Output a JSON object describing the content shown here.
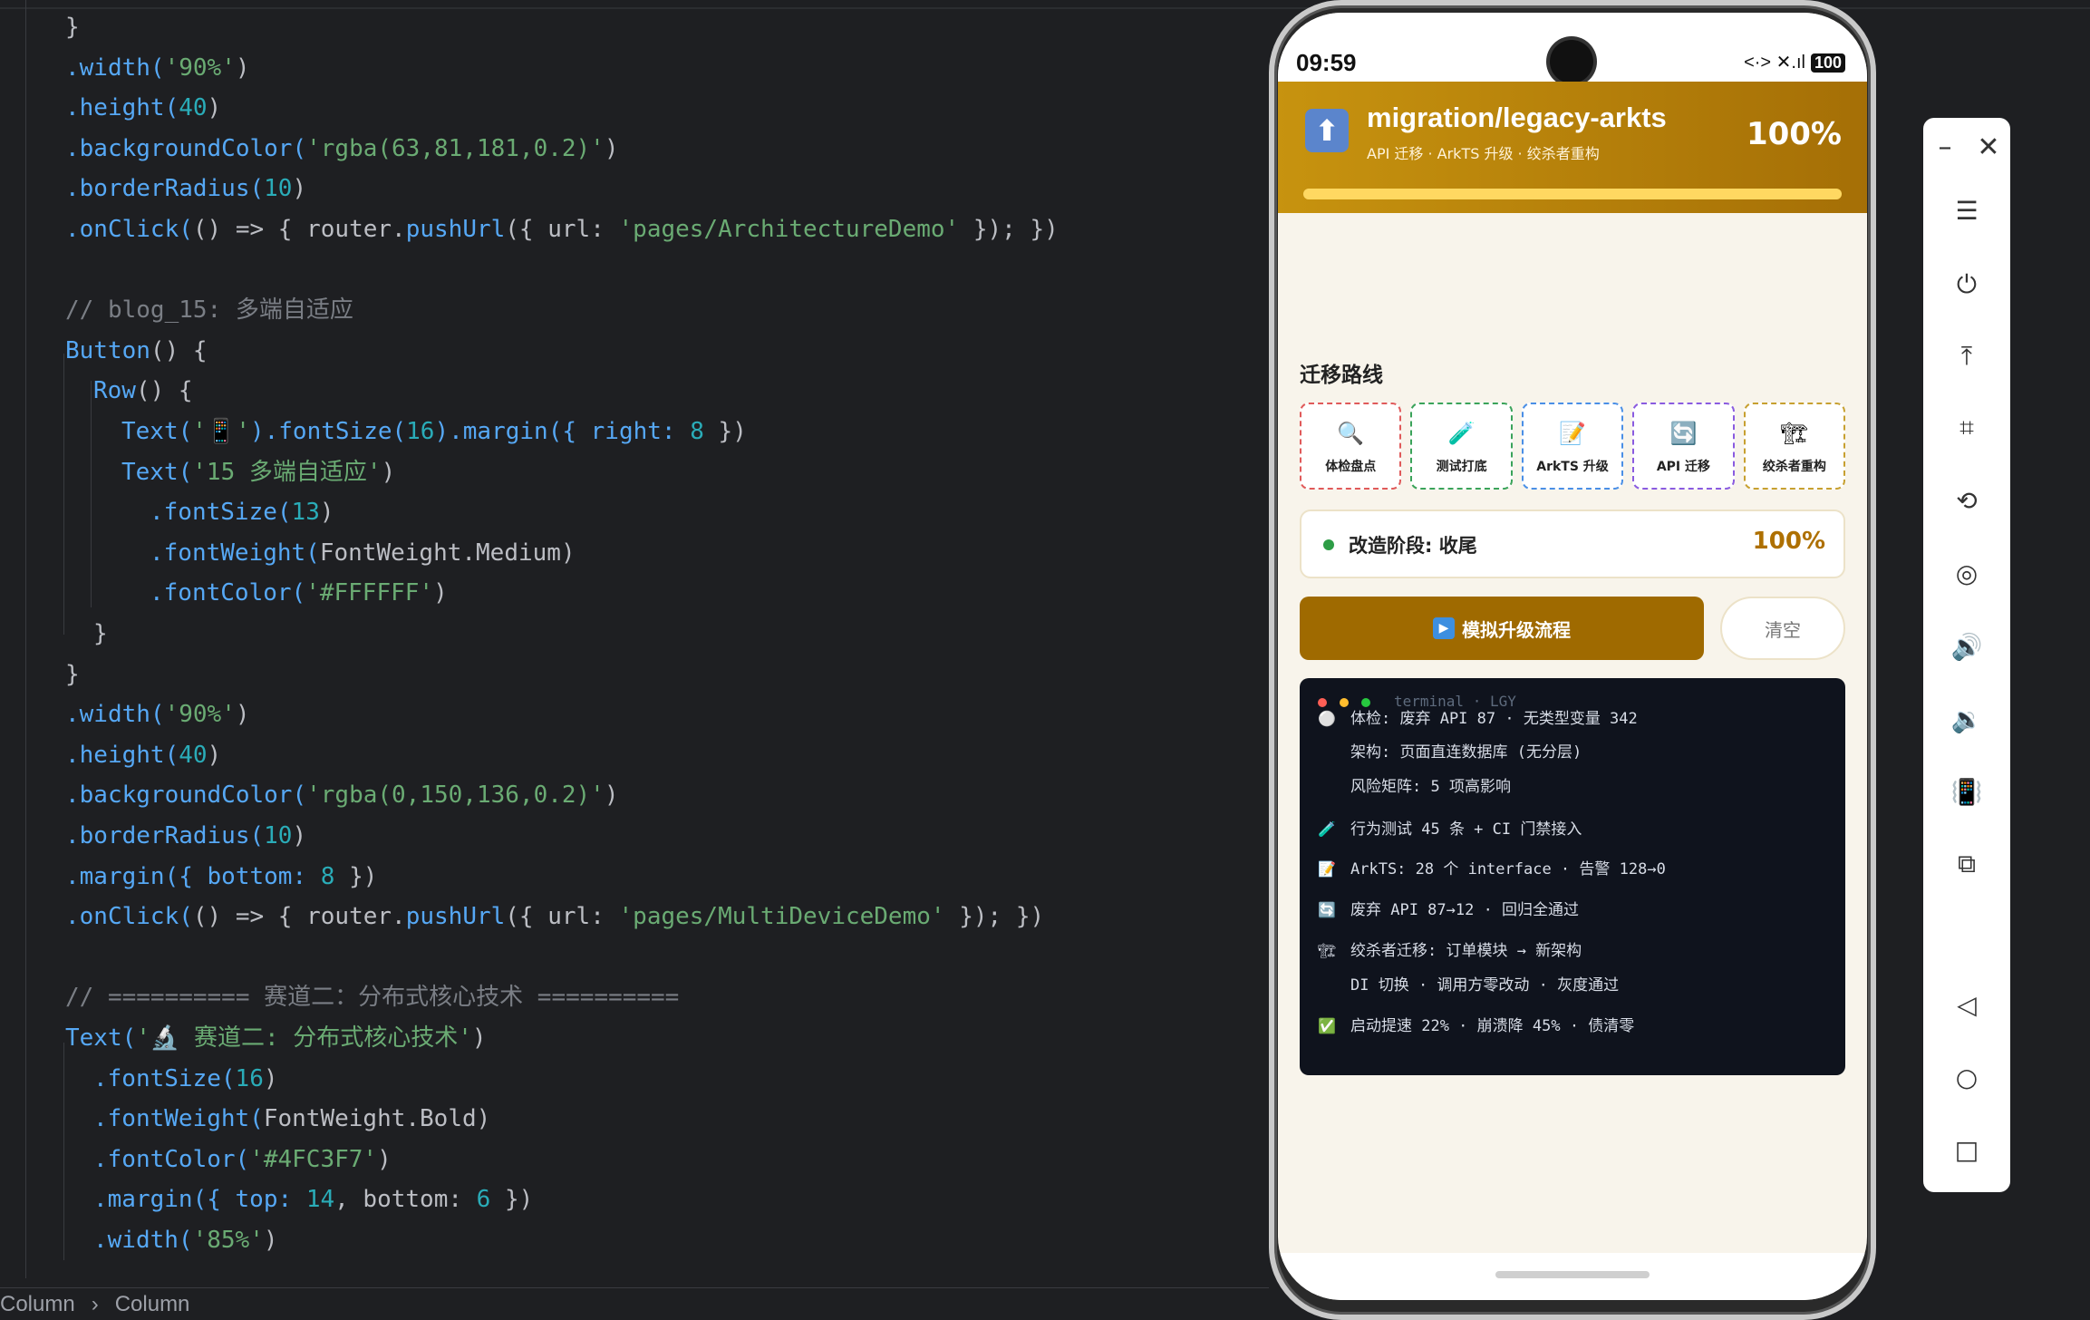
{
  "editor": {
    "lines": [
      {
        "indent": 2,
        "segs": [
          {
            "t": "}",
            "c": ""
          }
        ]
      },
      {
        "indent": 2,
        "segs": [
          {
            "t": ".width(",
            "c": "c-fn"
          },
          {
            "t": "'90%'",
            "c": "c-str"
          },
          {
            "t": ")",
            "c": ""
          }
        ]
      },
      {
        "indent": 2,
        "segs": [
          {
            "t": ".height(",
            "c": "c-fn"
          },
          {
            "t": "40",
            "c": "c-num"
          },
          {
            "t": ")",
            "c": ""
          }
        ]
      },
      {
        "indent": 2,
        "segs": [
          {
            "t": ".backgroundColor(",
            "c": "c-fn"
          },
          {
            "t": "'rgba(63,81,181,0.2)'",
            "c": "c-str"
          },
          {
            "t": ")",
            "c": ""
          }
        ]
      },
      {
        "indent": 2,
        "segs": [
          {
            "t": ".borderRadius(",
            "c": "c-fn"
          },
          {
            "t": "10",
            "c": "c-num"
          },
          {
            "t": ")",
            "c": ""
          }
        ]
      },
      {
        "indent": 2,
        "segs": [
          {
            "t": ".onClick(",
            "c": "c-fn"
          },
          {
            "t": "() => { router.",
            "c": ""
          },
          {
            "t": "pushUrl",
            "c": "c-fn"
          },
          {
            "t": "({ url: ",
            "c": ""
          },
          {
            "t": "'pages/ArchitectureDemo'",
            "c": "c-str"
          },
          {
            "t": " }); })",
            "c": ""
          }
        ]
      },
      {
        "indent": 2,
        "segs": [
          {
            "t": "",
            "c": ""
          }
        ]
      },
      {
        "indent": 2,
        "segs": [
          {
            "t": "// blog_15: 多端自适应",
            "c": "c-cm"
          }
        ]
      },
      {
        "indent": 2,
        "segs": [
          {
            "t": "Button",
            "c": "c-fn"
          },
          {
            "t": "() {",
            "c": ""
          }
        ]
      },
      {
        "indent": 3,
        "segs": [
          {
            "t": "Row",
            "c": "c-fn"
          },
          {
            "t": "() {",
            "c": ""
          }
        ]
      },
      {
        "indent": 4,
        "segs": [
          {
            "t": "Text(",
            "c": "c-fn"
          },
          {
            "t": "'📱'",
            "c": "c-str"
          },
          {
            "t": ").fontSize(",
            "c": "c-fn"
          },
          {
            "t": "16",
            "c": "c-num"
          },
          {
            "t": ").margin({ right: ",
            "c": "c-fn"
          },
          {
            "t": "8",
            "c": "c-num"
          },
          {
            "t": " })",
            "c": ""
          }
        ]
      },
      {
        "indent": 4,
        "segs": [
          {
            "t": "Text(",
            "c": "c-fn"
          },
          {
            "t": "'15 多端自适应'",
            "c": "c-str"
          },
          {
            "t": ")",
            "c": ""
          }
        ]
      },
      {
        "indent": 5,
        "segs": [
          {
            "t": ".fontSize(",
            "c": "c-fn"
          },
          {
            "t": "13",
            "c": "c-num"
          },
          {
            "t": ")",
            "c": ""
          }
        ]
      },
      {
        "indent": 5,
        "segs": [
          {
            "t": ".fontWeight(",
            "c": "c-fn"
          },
          {
            "t": "FontWeight.Medium",
            "c": ""
          },
          {
            "t": ")",
            "c": ""
          }
        ]
      },
      {
        "indent": 5,
        "segs": [
          {
            "t": ".fontColor(",
            "c": "c-fn"
          },
          {
            "t": "'#FFFFFF'",
            "c": "c-str"
          },
          {
            "t": ")",
            "c": ""
          }
        ]
      },
      {
        "indent": 3,
        "segs": [
          {
            "t": "}",
            "c": ""
          }
        ]
      },
      {
        "indent": 2,
        "segs": [
          {
            "t": "}",
            "c": ""
          }
        ]
      },
      {
        "indent": 2,
        "segs": [
          {
            "t": ".width(",
            "c": "c-fn"
          },
          {
            "t": "'90%'",
            "c": "c-str"
          },
          {
            "t": ")",
            "c": ""
          }
        ]
      },
      {
        "indent": 2,
        "segs": [
          {
            "t": ".height(",
            "c": "c-fn"
          },
          {
            "t": "40",
            "c": "c-num"
          },
          {
            "t": ")",
            "c": ""
          }
        ]
      },
      {
        "indent": 2,
        "segs": [
          {
            "t": ".backgroundColor(",
            "c": "c-fn"
          },
          {
            "t": "'rgba(0,150,136,0.2)'",
            "c": "c-str"
          },
          {
            "t": ")",
            "c": ""
          }
        ]
      },
      {
        "indent": 2,
        "segs": [
          {
            "t": ".borderRadius(",
            "c": "c-fn"
          },
          {
            "t": "10",
            "c": "c-num"
          },
          {
            "t": ")",
            "c": ""
          }
        ]
      },
      {
        "indent": 2,
        "segs": [
          {
            "t": ".margin({ bottom: ",
            "c": "c-fn"
          },
          {
            "t": "8",
            "c": "c-num"
          },
          {
            "t": " })",
            "c": ""
          }
        ]
      },
      {
        "indent": 2,
        "segs": [
          {
            "t": ".onClick(",
            "c": "c-fn"
          },
          {
            "t": "() => { router.",
            "c": ""
          },
          {
            "t": "pushUrl",
            "c": "c-fn"
          },
          {
            "t": "({ url: ",
            "c": ""
          },
          {
            "t": "'pages/MultiDeviceDemo'",
            "c": "c-str"
          },
          {
            "t": " }); })",
            "c": ""
          }
        ]
      },
      {
        "indent": 2,
        "segs": [
          {
            "t": "",
            "c": ""
          }
        ]
      },
      {
        "indent": 2,
        "segs": [
          {
            "t": "// ========== 赛道二：分布式核心技术 ==========",
            "c": "c-cm"
          }
        ]
      },
      {
        "indent": 2,
        "segs": [
          {
            "t": "Text(",
            "c": "c-fn"
          },
          {
            "t": "'🔬 赛道二: 分布式核心技术'",
            "c": "c-str"
          },
          {
            "t": ")",
            "c": ""
          }
        ]
      },
      {
        "indent": 3,
        "segs": [
          {
            "t": ".fontSize(",
            "c": "c-fn"
          },
          {
            "t": "16",
            "c": "c-num"
          },
          {
            "t": ")",
            "c": ""
          }
        ]
      },
      {
        "indent": 3,
        "segs": [
          {
            "t": ".fontWeight(",
            "c": "c-fn"
          },
          {
            "t": "FontWeight.Bold",
            "c": ""
          },
          {
            "t": ")",
            "c": ""
          }
        ]
      },
      {
        "indent": 3,
        "segs": [
          {
            "t": ".fontColor(",
            "c": "c-fn"
          },
          {
            "t": "'#4FC3F7'",
            "c": "c-str"
          },
          {
            "t": ")",
            "c": ""
          }
        ]
      },
      {
        "indent": 3,
        "segs": [
          {
            "t": ".margin({ top: ",
            "c": "c-fn"
          },
          {
            "t": "14",
            "c": "c-num"
          },
          {
            "t": ", bottom: ",
            "c": ""
          },
          {
            "t": "6",
            "c": "c-num"
          },
          {
            "t": " })",
            "c": ""
          }
        ]
      },
      {
        "indent": 3,
        "segs": [
          {
            "t": ".width(",
            "c": "c-fn"
          },
          {
            "t": "'85%'",
            "c": "c-str"
          },
          {
            "t": ")",
            "c": ""
          }
        ]
      }
    ]
  },
  "statusbar": {
    "crumb1": "Column",
    "sep": "›",
    "crumb2": "Column"
  },
  "phone": {
    "time": "09:59",
    "signal": "<·> ✕.ıl",
    "battery": "100",
    "banner": {
      "icon": "⬆",
      "title": "migration/legacy-arkts",
      "subtitle": "API 迁移 · ArkTS 升级 · 绞杀者重构",
      "percent": "100%",
      "progress": 1.0
    },
    "section_title": "迁移路线",
    "steps": [
      {
        "icon": "🔍",
        "label": "体检盘点",
        "color": "#e05a5a"
      },
      {
        "icon": "🧪",
        "label": "测试打底",
        "color": "#3aa35a"
      },
      {
        "icon": "📝",
        "label": "ArkTS 升级",
        "color": "#4a8fe6"
      },
      {
        "icon": "🔄",
        "label": "API 迁移",
        "color": "#8a5be0"
      },
      {
        "icon": "🏗",
        "label": "绞杀者重构",
        "color": "#c7a030"
      }
    ],
    "stage": {
      "label": "改造阶段: 收尾",
      "percent": "100%"
    },
    "run_button": "模拟升级流程",
    "clear_button": "清空",
    "terminal": {
      "title": "terminal · LGY",
      "lines": [
        {
          "icon": "⚪",
          "text": "体检: 废弃 API 87 · 无类型变量 342"
        },
        {
          "icon": "",
          "text": "架构: 页面直连数据库 (无分层)"
        },
        {
          "icon": "",
          "text": "风险矩阵: 5 项高影响"
        },
        {
          "icon": "🧪",
          "text": "行为测试 45 条 + CI 门禁接入"
        },
        {
          "icon": "📝",
          "text": "ArkTS: 28 个 interface · 告警 128→0"
        },
        {
          "icon": "🔄",
          "text": "废弃 API 87→12 · 回归全通过"
        },
        {
          "icon": "🏗",
          "text": "绞杀者迁移: 订单模块 → 新架构"
        },
        {
          "icon": "",
          "text": "DI 切换 · 调用方零改动 · 灰度通过"
        },
        {
          "icon": "✅",
          "text": "启动提速 22% · 崩溃降 45% · 债清零"
        }
      ]
    }
  },
  "side_panel": {
    "minimize": "–",
    "close": "✕",
    "buttons": [
      {
        "name": "menu-icon",
        "glyph": "☰"
      },
      {
        "name": "power-icon",
        "glyph": "⏻"
      },
      {
        "name": "pin-top-icon",
        "glyph": "⤒"
      },
      {
        "name": "crop-icon",
        "glyph": "⌗"
      },
      {
        "name": "rotate-icon",
        "glyph": "⟲"
      },
      {
        "name": "screen-record-icon",
        "glyph": "◎"
      },
      {
        "name": "volume-up-icon",
        "glyph": "🔊"
      },
      {
        "name": "volume-down-icon",
        "glyph": "🔉"
      },
      {
        "name": "shake-icon",
        "glyph": "📳"
      },
      {
        "name": "multi-device-icon",
        "glyph": "⧉"
      },
      {
        "name": "back-icon",
        "glyph": "◁"
      },
      {
        "name": "home-icon",
        "glyph": "○"
      },
      {
        "name": "recents-icon",
        "glyph": "□"
      }
    ]
  }
}
